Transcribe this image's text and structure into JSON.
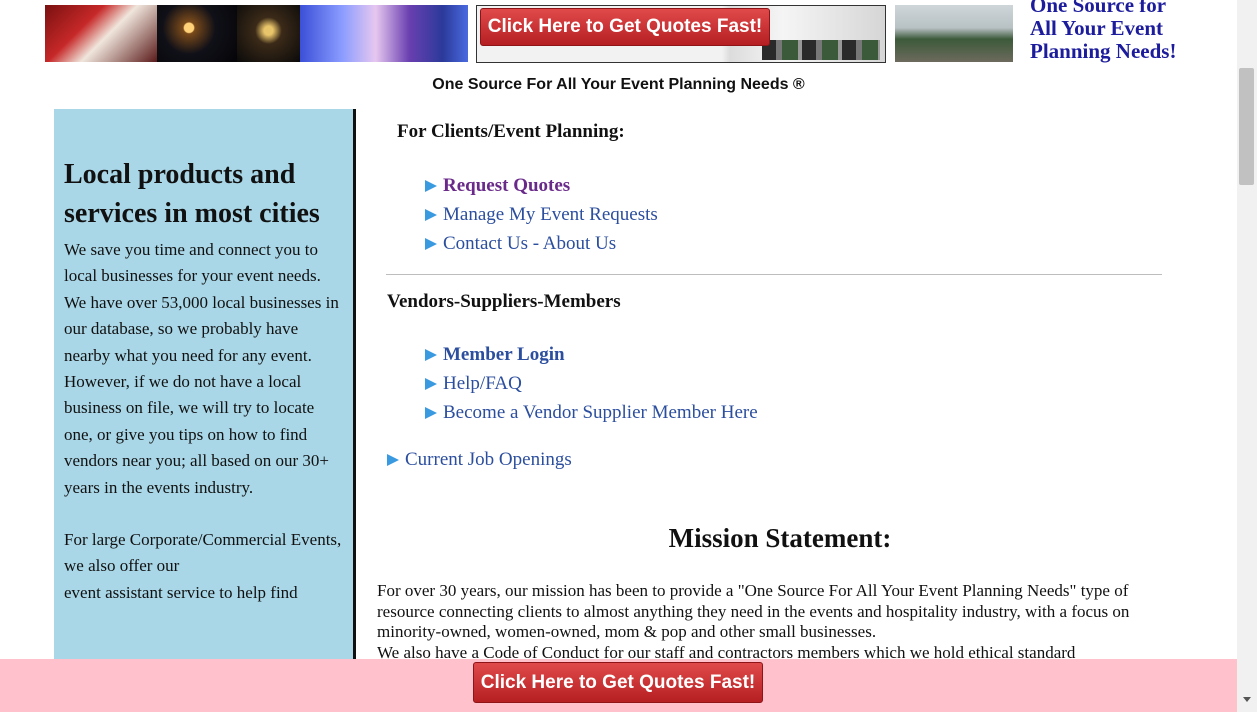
{
  "banner": {
    "cta_label": "Click Here to Get Quotes Fast!",
    "brand_lines": [
      "One Source for",
      "All Your Event",
      "Planning Needs!"
    ],
    "photos": [
      "santa-photo",
      "fireworks-photo",
      "fireworks-night-photo",
      "dance-floor-photo",
      "tent-rental-photo",
      "event-tent-photo"
    ]
  },
  "tagline": "One Source For All Your Event Planning Needs ®",
  "sidebar": {
    "heading": "Local products and services in most cities",
    "paragraphs": [
      "We save you time and connect you to local businesses for your event needs.",
      "We have over 53,000 local businesses in our database, so we probably have nearby what you need for any event.",
      "However, if we do not have a local business on file, we will try to locate one, or give you tips on how to find vendors near you; all based on our 30+ years in the events industry.",
      "For large Corporate/Commercial Events, we also offer our",
      "event assistant service to help find"
    ]
  },
  "clients": {
    "title": "For Clients/Event Planning:",
    "links": [
      "Request Quotes",
      "Manage My Event Requests",
      "Contact Us - About Us"
    ]
  },
  "vendors": {
    "title": "Vendors-Suppliers-Members",
    "links": [
      "Member Login",
      "Help/FAQ",
      "Become a Vendor Supplier Member Here"
    ]
  },
  "jobs_link": "Current Job Openings",
  "mission": {
    "title": "Mission Statement:",
    "text": "For over 30 years, our mission has been to provide a \"One Source For All Your Event Planning Needs\" type of resource connecting clients to almost anything they need in the events and hospitality industry, with a focus on minority-owned, women-owned, mom & pop and other small businesses.",
    "more": "We also have a Code of Conduct for our staff and contractors members which we hold ethical standard"
  },
  "bottom_bar": {
    "cta_label": "Click Here to Get Quotes Fast!"
  },
  "colors": {
    "sidebar_bg": "#a9d7e7",
    "link": "#2b4e9e",
    "visited_link": "#6a2a8a",
    "cta_red": "#c62a2e",
    "bottom_bar": "#ffc1cc",
    "brand_blue": "#1c1c9c"
  }
}
